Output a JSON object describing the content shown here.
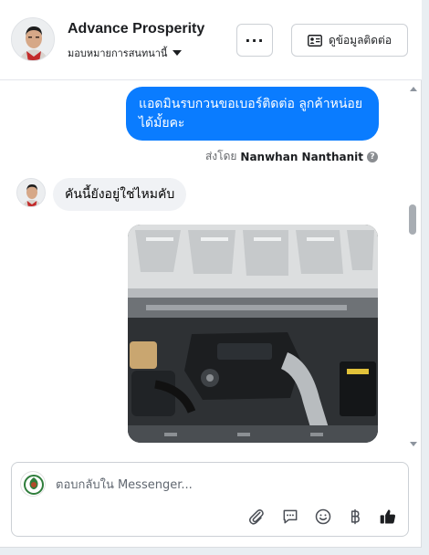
{
  "header": {
    "page_name": "Advance Prosperity",
    "assign_label": "มอบหมายการสนทนานี้",
    "more_label": "···",
    "contact_label": "ดูข้อมูลติดต่อ"
  },
  "messages": [
    {
      "direction": "outgoing",
      "text": "แอดมินรบกวนขอเบอร์ติดต่อ ลูกค้าหน่อยได้มั้ยคะ"
    },
    {
      "direction": "incoming",
      "text": "คันนี้ยังอยู่ใช่ไหมคับ"
    }
  ],
  "sent_by": {
    "prefix": "ส่งโดย",
    "name": "Nanwhan Nanthanit",
    "help_glyph": "?"
  },
  "attachment": {
    "type": "photo",
    "subject": "engine-bay"
  },
  "composer": {
    "placeholder": "ตอบกลับใน Messenger...",
    "tools": [
      "attachment-icon",
      "saved-reply-icon",
      "emoji-icon",
      "baht-icon",
      "thumbs-up-icon"
    ]
  },
  "colors": {
    "outgoing_bubble": "#0a7cff",
    "incoming_bubble": "#f0f2f5",
    "accent": "#1c1e21"
  }
}
